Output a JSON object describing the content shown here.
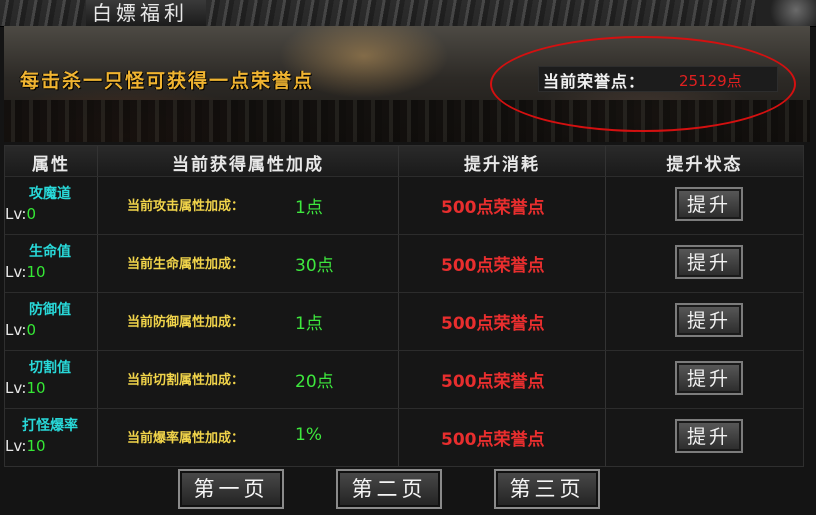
{
  "window": {
    "title": "白嫖福利"
  },
  "banner": {
    "message": "每击杀一只怪可获得一点荣誉点",
    "honor_label": "当前荣誉点：",
    "honor_value": "25129点"
  },
  "table": {
    "headers": [
      "属性",
      "当前获得属性加成",
      "提升消耗",
      "提升状态"
    ],
    "rows": [
      {
        "name": "攻魔道",
        "lv_prefix": "Lv:",
        "lv": "0",
        "bonus_label": "当前攻击属性加成：",
        "bonus_value": "1点",
        "cost": "500点荣誉点",
        "button": "提升"
      },
      {
        "name": "生命值",
        "lv_prefix": "Lv:",
        "lv": "10",
        "bonus_label": "当前生命属性加成：",
        "bonus_value": "30点",
        "cost": "500点荣誉点",
        "button": "提升"
      },
      {
        "name": "防御值",
        "lv_prefix": "Lv:",
        "lv": "0",
        "bonus_label": "当前防御属性加成：",
        "bonus_value": "1点",
        "cost": "500点荣誉点",
        "button": "提升"
      },
      {
        "name": "切割值",
        "lv_prefix": "Lv:",
        "lv": "10",
        "bonus_label": "当前切割属性加成：",
        "bonus_value": "20点",
        "cost": "500点荣誉点",
        "button": "提升"
      },
      {
        "name": "打怪爆率",
        "lv_prefix": "Lv:",
        "lv": "10",
        "bonus_label": "当前爆率属性加成：",
        "bonus_value": "1%",
        "cost": "500点荣誉点",
        "button": "提升"
      }
    ]
  },
  "pager": {
    "page1": "第一页",
    "page2": "第二页",
    "page3": "第三页"
  },
  "colors": {
    "honor_ring": "#d41010",
    "cost": "#e82e2e",
    "bonus": "#3ee83e",
    "attr": "#28d8d8",
    "banner_text": "#f0b431"
  }
}
